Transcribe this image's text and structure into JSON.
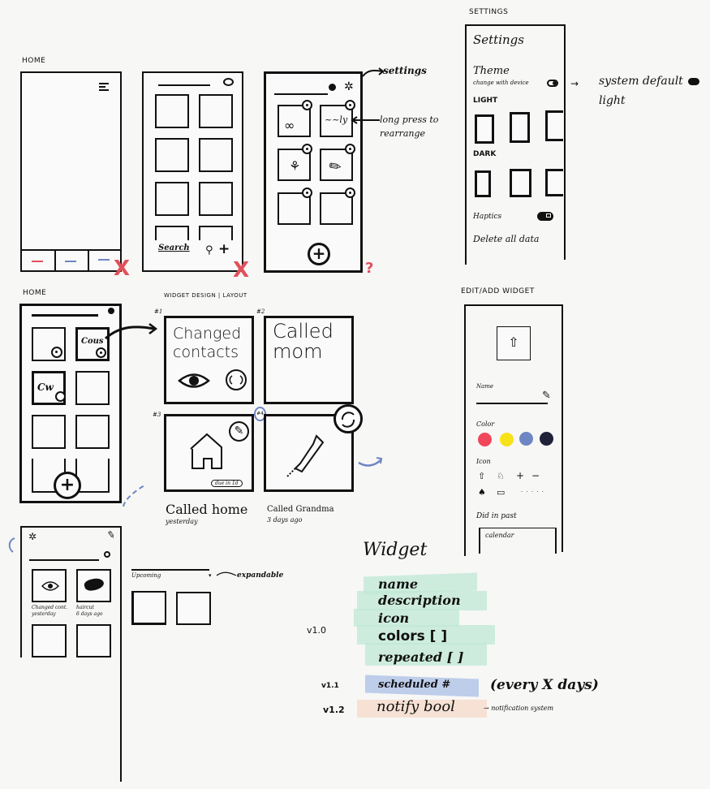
{
  "colors": {
    "ink": "#111111",
    "paper": "#f7f7f6",
    "red_mark": "#e0505b",
    "blue_ink": "#6f86c4",
    "mint_highlight": "#bfe8d4",
    "blue_highlight": "#a9bfe6",
    "peach_highlight": "#f6d9c8",
    "swatch_red": "#f0475a",
    "swatch_yellow": "#f7e21a",
    "swatch_blue": "#6f86c4",
    "swatch_navy": "#1f2238"
  },
  "section_labels": {
    "home_v1": "HOME",
    "settings": "SETTINGS",
    "home_v2": "HOME",
    "widget_design": "WIDGET DESIGN | LAYOUT",
    "edit_add_widget": "EDIT/ADD WIDGET"
  },
  "home_v1": {
    "menu_icon": "hamburger-icon",
    "tab_marks": [
      "red-dash",
      "blue-dash",
      "blue-dash"
    ],
    "rejected_mark": "X"
  },
  "home_v2": {
    "search_label": "Search",
    "rejected_mark": "X"
  },
  "home_v3": {
    "annotations": {
      "settings": "settings",
      "long_press": "long press to rearrange"
    },
    "question_mark": "?",
    "widget_icons": [
      "glasses",
      "scribble",
      "plant",
      "pencil",
      "empty",
      "empty"
    ]
  },
  "settings": {
    "title": "Settings",
    "theme_label": "Theme",
    "change_with_device": "change with device",
    "arrow_note": "system default",
    "arrow_note_2": "light",
    "light_label": "LIGHT",
    "dark_label": "DARK",
    "haptics_label": "Haptics",
    "delete_label": "Delete all data"
  },
  "widget_design": {
    "tiles": [
      {
        "num": "#1",
        "title": "Changed contacts",
        "icons": [
          "eye-icon",
          "refresh-icon"
        ]
      },
      {
        "num": "#2",
        "title": "Called mom"
      },
      {
        "num": "#3",
        "caption": "Called home",
        "subcaption": "yesterday",
        "badge": "due in 1d",
        "icon": "house-icon"
      },
      {
        "num": "#4",
        "caption": "Called Grandma",
        "subcaption": "3 days ago",
        "icon": "phone-icon"
      }
    ]
  },
  "home_v4": {
    "widgets": [
      {
        "caption": "Changed cont.",
        "sub": "yesterday"
      },
      {
        "caption": "haircut",
        "sub": "6 days ago"
      }
    ],
    "upcoming_label": "Upcoming",
    "expandable_note": "expandable"
  },
  "edit_widget": {
    "name_label": "Name",
    "color_label": "Color",
    "icon_label": "Icon",
    "icon_row1": [
      "⇧",
      "♘",
      "+",
      "−"
    ],
    "icon_row2": [
      "♠",
      "▭",
      "· · · · ·"
    ],
    "did_in_past": "Did in past",
    "calendar": "calendar"
  },
  "widget_spec": {
    "title": "Widget",
    "versions": [
      {
        "version": "v1.0",
        "fields": [
          "name",
          "description",
          "icon",
          "colors [ ]",
          "repeated [ ]"
        ]
      },
      {
        "version": "v1.1",
        "fields": [
          "scheduled #"
        ],
        "note": "(every X days)"
      },
      {
        "version": "v1.2",
        "fields": [
          "notify bool"
        ],
        "note": "→ notification system"
      }
    ]
  }
}
